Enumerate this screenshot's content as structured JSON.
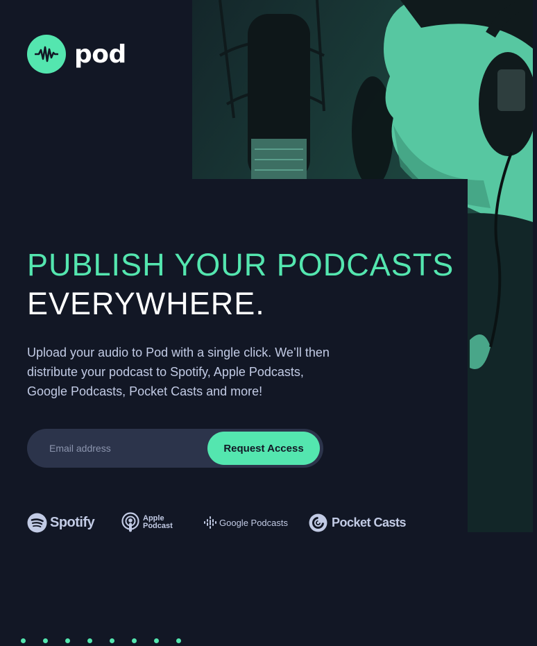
{
  "brand": {
    "name": "pod",
    "logo_icon": "waveform-icon",
    "accent_color": "#54e6af",
    "background_color": "#121725"
  },
  "hero": {
    "heading_line1": "PUBLISH YOUR PODCASTS",
    "heading_line2": "EVERYWHERE.",
    "description": "Upload your audio to Pod with a single click. We’ll then distribute your podcast to Spotify, Apple Podcasts, Google Podcasts, Pocket Casts and more!",
    "image_icon": "podcaster-microphone-photo"
  },
  "form": {
    "email_placeholder": "Email address",
    "email_value": "",
    "submit_label": "Request Access"
  },
  "platforms": [
    {
      "name": "Spotify",
      "icon": "spotify-icon"
    },
    {
      "name_line1": "Apple",
      "name_line2": "Podcast",
      "icon": "apple-podcast-icon"
    },
    {
      "name": "Google Podcasts",
      "icon": "google-podcasts-icon"
    },
    {
      "name": "Pocket Casts",
      "icon": "pocket-casts-icon"
    }
  ],
  "decoration": {
    "dot_count": 8
  }
}
